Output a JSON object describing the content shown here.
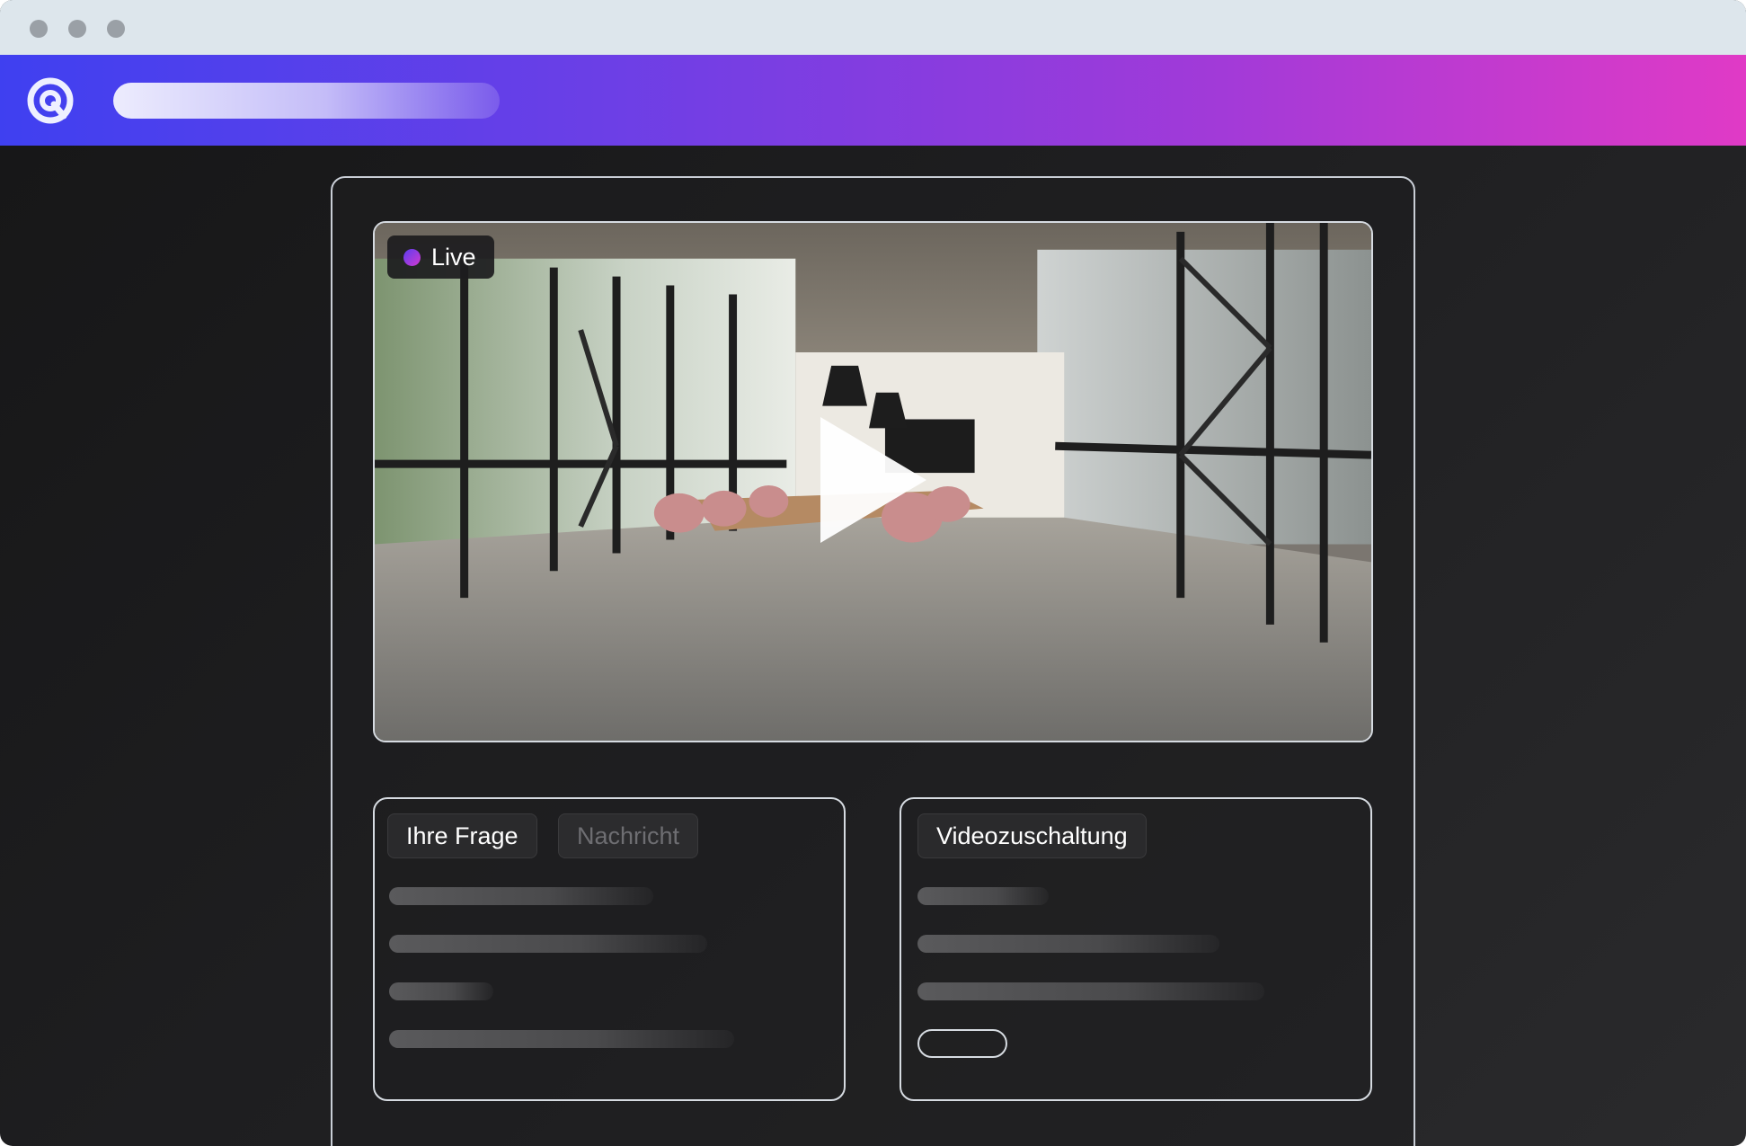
{
  "badge": {
    "live": "Live"
  },
  "question_box": {
    "tabs": [
      {
        "label": "Ihre Frage",
        "active": true
      },
      {
        "label": "Nachricht",
        "active": false
      }
    ]
  },
  "video_box": {
    "tab_label": "Videozuschaltung"
  },
  "colors": {
    "header_gradient_start": "#3f40f0",
    "header_gradient_end": "#e03ac6",
    "background": "#1f1f21"
  },
  "icons": [
    "brand-logo-icon",
    "live-dot-icon",
    "play-icon"
  ]
}
